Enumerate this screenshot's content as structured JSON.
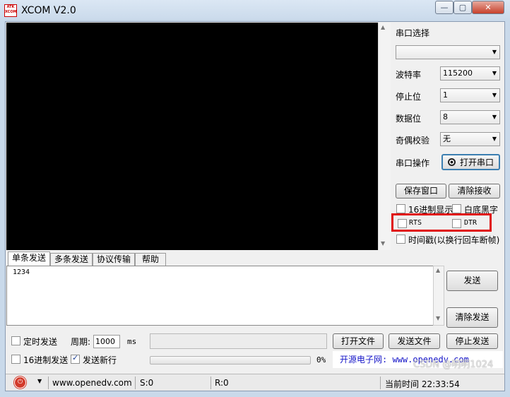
{
  "app": {
    "title": "XCOM V2.0",
    "logo_lines": [
      "ATK",
      "XCOM"
    ],
    "window_controls": [
      "—",
      "▢",
      "✕"
    ]
  },
  "right_panel": {
    "port_select_label": "串口选择",
    "port_value": "",
    "baud_label": "波特率",
    "baud_value": "115200",
    "stop_label": "停止位",
    "stop_value": "1",
    "data_label": "数据位",
    "data_value": "8",
    "parity_label": "奇偶校验",
    "parity_value": "无",
    "serial_op_label": "串口操作",
    "open_port_button": "打开串口",
    "save_window_button": "保存窗口",
    "clear_receive_button": "清除接收",
    "hex_display_label": "16进制显示",
    "white_bg_label": "白底黑字",
    "rts_label": "RTS",
    "dtr_label": "DTR",
    "timestamp_label": "时间戳(以换行回车断帧)"
  },
  "tabs": [
    "单条发送",
    "多条发送",
    "协议传输",
    "帮助"
  ],
  "send": {
    "text": "1234",
    "send_button": "发送",
    "clear_send_button": "清除发送",
    "timed_send_label": "定时发送",
    "period_label": "周期:",
    "period_value": "1000",
    "period_unit": "ms",
    "open_file_button": "打开文件",
    "send_file_button": "发送文件",
    "stop_send_button": "停止发送",
    "hex_send_label": "16进制发送",
    "newline_label": "发送新行",
    "newline_checked": true,
    "progress_text": "0%",
    "progress_value": 0
  },
  "banner": "开源电子网: www.openedv.com",
  "status": {
    "url": "www.openedv.com",
    "sent": "S:0",
    "received": "R:0",
    "time": "当前时间 22:33:54"
  },
  "watermark": "CSDN @明明1024",
  "colors": {
    "receive_background": "#000000",
    "highlight_border": "#e01010",
    "banner_text": "#1515c8"
  }
}
